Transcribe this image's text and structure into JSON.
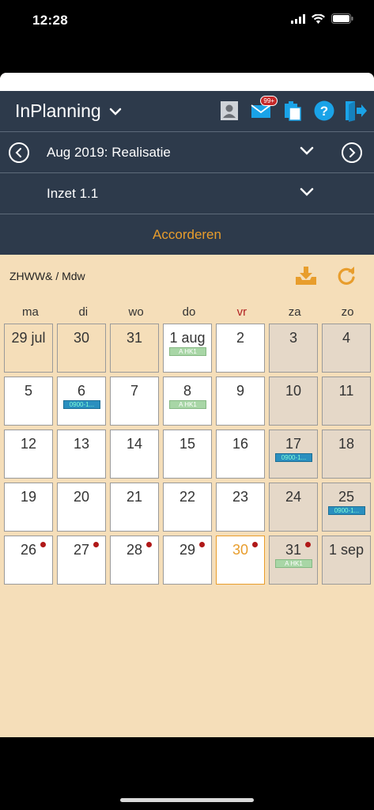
{
  "status": {
    "time": "12:28"
  },
  "header": {
    "title": "InPlanning",
    "mail_badge": "99+"
  },
  "period": {
    "label": "Aug 2019: Realisatie"
  },
  "inzet": {
    "label": "Inzet 1.1"
  },
  "accord": {
    "label": "Accorderen"
  },
  "calendar": {
    "org_label": "ZHWW& / Mdw",
    "weekdays": [
      "ma",
      "di",
      "wo",
      "do",
      "vr",
      "za",
      "zo"
    ],
    "weeks": [
      [
        {
          "label": "29 jul",
          "type": "muted"
        },
        {
          "label": "30",
          "type": "muted"
        },
        {
          "label": "31",
          "type": "muted"
        },
        {
          "label": "1 aug",
          "type": "normal",
          "tag": "A HK1",
          "tagColor": "green"
        },
        {
          "label": "2",
          "type": "normal"
        },
        {
          "label": "3",
          "type": "weekend"
        },
        {
          "label": "4",
          "type": "weekend"
        }
      ],
      [
        {
          "label": "5",
          "type": "normal"
        },
        {
          "label": "6",
          "type": "normal",
          "tag": "0900-1...",
          "tagColor": "blue"
        },
        {
          "label": "7",
          "type": "normal"
        },
        {
          "label": "8",
          "type": "normal",
          "tag": "A HK1",
          "tagColor": "green"
        },
        {
          "label": "9",
          "type": "normal"
        },
        {
          "label": "10",
          "type": "weekend"
        },
        {
          "label": "11",
          "type": "weekend"
        }
      ],
      [
        {
          "label": "12",
          "type": "normal"
        },
        {
          "label": "13",
          "type": "normal"
        },
        {
          "label": "14",
          "type": "normal"
        },
        {
          "label": "15",
          "type": "normal"
        },
        {
          "label": "16",
          "type": "normal"
        },
        {
          "label": "17",
          "type": "weekend",
          "tag": "0900-1...",
          "tagColor": "blue"
        },
        {
          "label": "18",
          "type": "weekend"
        }
      ],
      [
        {
          "label": "19",
          "type": "normal"
        },
        {
          "label": "20",
          "type": "normal"
        },
        {
          "label": "21",
          "type": "normal"
        },
        {
          "label": "22",
          "type": "normal"
        },
        {
          "label": "23",
          "type": "normal"
        },
        {
          "label": "24",
          "type": "weekend"
        },
        {
          "label": "25",
          "type": "weekend",
          "tag": "0900-1...",
          "tagColor": "blue"
        }
      ],
      [
        {
          "label": "26",
          "type": "normal",
          "dot": true
        },
        {
          "label": "27",
          "type": "normal",
          "dot": true
        },
        {
          "label": "28",
          "type": "normal",
          "dot": true
        },
        {
          "label": "29",
          "type": "normal",
          "dot": true
        },
        {
          "label": "30",
          "type": "today",
          "dot": true
        },
        {
          "label": "31",
          "type": "weekend",
          "dot": true,
          "tag": "A HK1",
          "tagColor": "green"
        },
        {
          "label": "1 sep",
          "type": "weekend"
        }
      ]
    ]
  },
  "colors": {
    "header_bg": "#2d3a4b",
    "accent": "#e89d2c",
    "calendar_bg": "#f5deb9",
    "icon_blue": "#1aa3e8"
  }
}
